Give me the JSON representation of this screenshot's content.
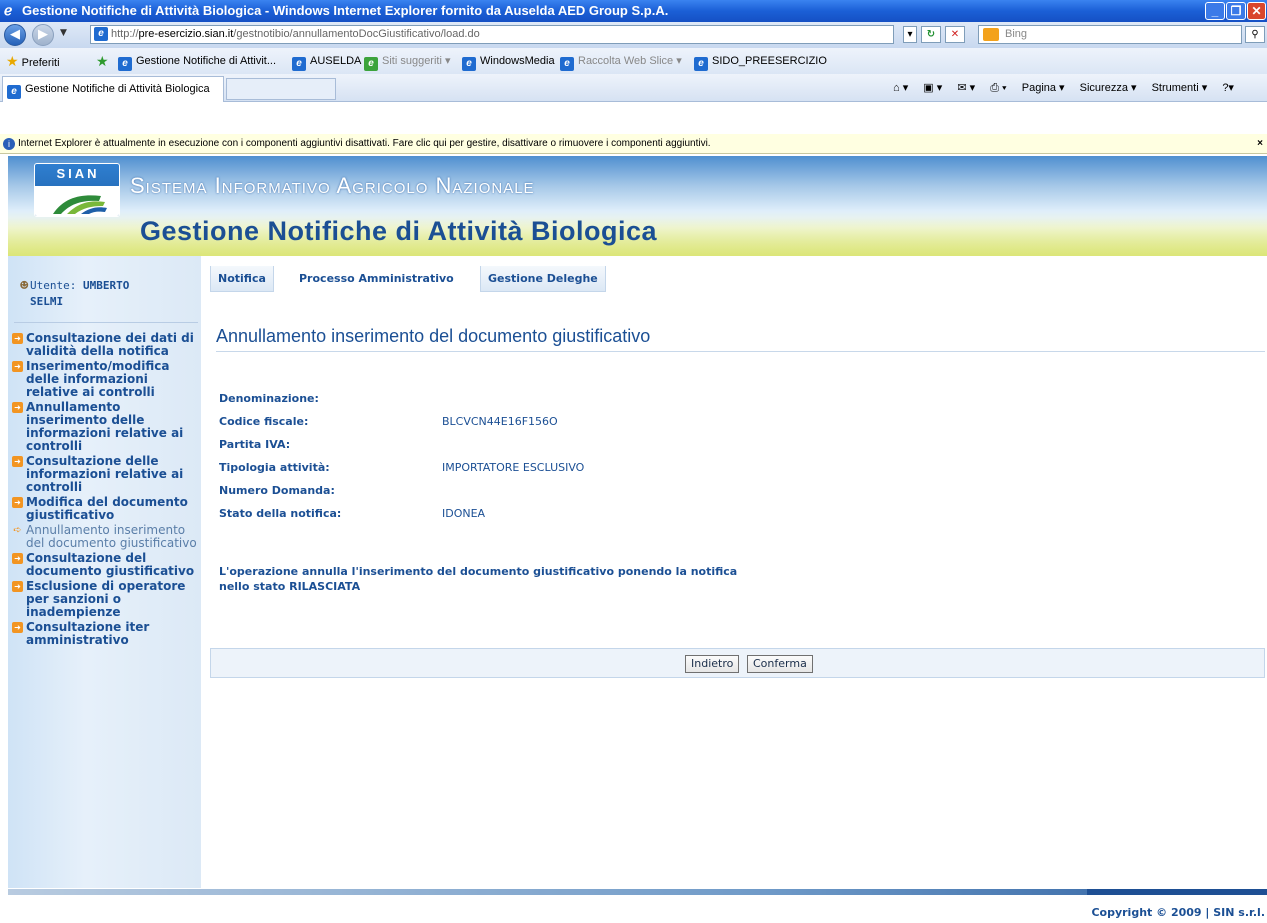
{
  "window": {
    "title": "Gestione Notifiche di Attività Biologica - Windows Internet Explorer fornito da Auselda AED Group S.p.A.",
    "controls": {
      "minimize": "_",
      "maximize": "❐",
      "close": "✕"
    }
  },
  "addressbar": {
    "url_prefix": "http://",
    "url_domain": "pre-esercizio.sian.it",
    "url_path": "/gestnotibio/annullamentoDocGiustificativo/load.do",
    "search_placeholder": "Bing"
  },
  "favorites": {
    "label": "Preferiti",
    "items": [
      {
        "label": "Gestione Notifiche di Attivit..."
      },
      {
        "label": "AUSELDA"
      },
      {
        "label": "Siti suggeriti ▾"
      },
      {
        "label": "WindowsMedia"
      },
      {
        "label": "Raccolta Web Slice ▾"
      },
      {
        "label": "SIDO_PREESERCIZIO"
      }
    ]
  },
  "tabs": {
    "active": "Gestione Notifiche di Attività Biologica"
  },
  "commandbar": {
    "pagina": "Pagina ▾",
    "sicurezza": "Sicurezza ▾",
    "strumenti": "Strumenti ▾"
  },
  "infobar": {
    "text": "Internet Explorer è attualmente in esecuzione con i componenti aggiuntivi disattivati. Fare clic qui per gestire, disattivare o rimuovere i componenti aggiuntivi.",
    "close": "×"
  },
  "banner": {
    "logo": "SIAN",
    "system_title": "Sistema Informativo Agricolo Nazionale",
    "app_title": "Gestione Notifiche di Attività Biologica"
  },
  "user": {
    "label": "Utente:",
    "name_line1": "UMBERTO",
    "name_line2": "SELMI"
  },
  "menu": [
    {
      "label": "Consultazione dei dati di validità della notifica"
    },
    {
      "label": "Inserimento/modifica delle informazioni relative ai controlli"
    },
    {
      "label": "Annullamento inserimento delle informazioni relative ai controlli"
    },
    {
      "label": "Consultazione delle informazioni relative ai controlli"
    },
    {
      "label": "Modifica del documento giustificativo"
    },
    {
      "label": "Annullamento inserimento del documento giustificativo"
    },
    {
      "label": "Consultazione del documento giustificativo"
    },
    {
      "label": "Esclusione di operatore per sanzioni o inadempienze"
    },
    {
      "label": "Consultazione iter amministrativo"
    }
  ],
  "nav": {
    "notifica": "Notifica",
    "processo": "Processo Amministrativo",
    "deleghe": "Gestione Deleghe"
  },
  "content": {
    "heading": "Annullamento inserimento del documento giustificativo",
    "fields": [
      {
        "label": "Denominazione:",
        "value": ""
      },
      {
        "label": "Codice fiscale:",
        "value": "BLCVCN44E16F156O"
      },
      {
        "label": "Partita IVA:",
        "value": ""
      },
      {
        "label": "Tipologia attività:",
        "value": "IMPORTATORE ESCLUSIVO"
      },
      {
        "label": "Numero Domanda:",
        "value": ""
      },
      {
        "label": "Stato della notifica:",
        "value": "IDONEA"
      }
    ],
    "note": "L'operazione annulla l'inserimento del documento giustificativo ponendo la notifica nello stato RILASCIATA",
    "back_button": "Indietro",
    "confirm_button": "Conferma"
  },
  "footer": {
    "copyright": "Copyright © 2009 | SIN s.r.l."
  }
}
